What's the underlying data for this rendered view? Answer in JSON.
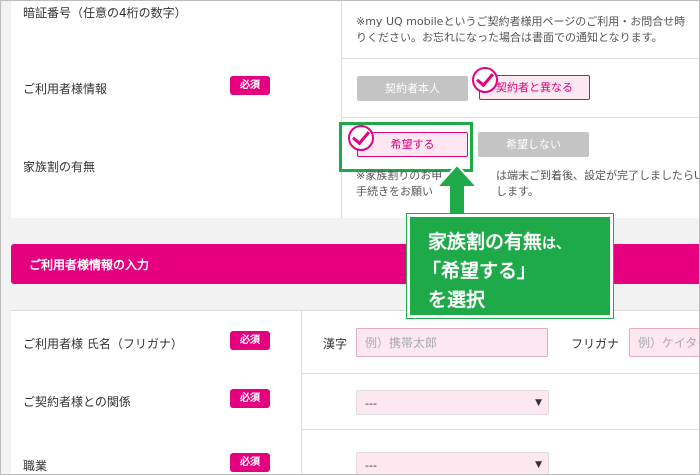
{
  "rows": {
    "pin": {
      "label": "暗証番号（任意の4桁の数字）",
      "note1": "※my UQ mobileというご契約者様用ページのご利用・お問合せ時",
      "note2": "りください。お忘れになった場合は書面での通知となります。"
    },
    "user_info": {
      "label": "ご利用者様情報",
      "required": "必須",
      "option1": "契約者本人",
      "option2": "契約者と異なる"
    },
    "family": {
      "label": "家族割の有無",
      "option1": "希望する",
      "option2": "希望しない",
      "note1": "※家族割りのお申",
      "note1b": "は端末ご到着後、設定が完了しましたらUQ公",
      "note2": "手続きをお願い",
      "note2b": "します。"
    }
  },
  "section": {
    "title": "ご利用者様情報の入力"
  },
  "form": {
    "name": {
      "label": "ご利用者様 氏名（フリガナ）",
      "required": "必須",
      "kanji_label": "漢字",
      "kanji_placeholder": "例）携帯太郎",
      "kana_label": "フリガナ",
      "kana_placeholder": "例）ケイタイ"
    },
    "relation": {
      "label": "ご契約者様との関係",
      "required": "必須",
      "value": "---"
    },
    "job": {
      "label": "職業",
      "required": "必須",
      "value": "---"
    }
  },
  "callout": {
    "line1a": "家族割の有無",
    "line1b": "は、",
    "line2": "「希望する」",
    "line3": "を選択"
  },
  "colors": {
    "accent": "#e4007f",
    "highlight": "#1eaa48"
  }
}
